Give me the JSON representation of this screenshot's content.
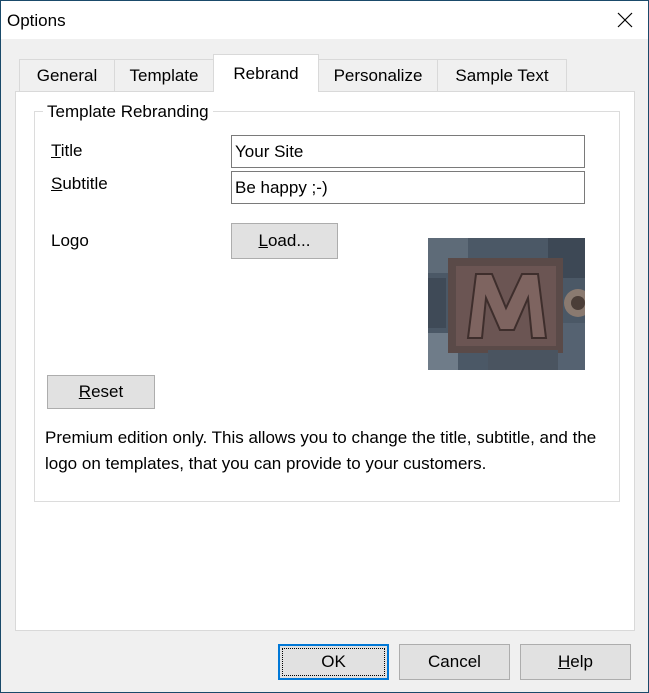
{
  "window": {
    "title": "Options"
  },
  "tabs": [
    {
      "label": "General"
    },
    {
      "label": "Template"
    },
    {
      "label": "Rebrand"
    },
    {
      "label": "Personalize"
    },
    {
      "label": "Sample Text"
    }
  ],
  "active_tab": "Rebrand",
  "group": {
    "title": "Template Rebranding",
    "title_label": {
      "mnemonic": "T",
      "rest": "itle"
    },
    "title_value": "Your Site",
    "subtitle_label": {
      "mnemonic": "S",
      "rest": "ubtitle"
    },
    "subtitle_value": "Be happy ;-)",
    "logo_label": "Logo",
    "load_button": {
      "mnemonic": "L",
      "rest": "oad..."
    },
    "reset_button": {
      "mnemonic": "R",
      "rest": "eset"
    },
    "description": "Premium edition only. This allows you to change the title, subtitle, and the logo on templates, that you can provide to your customers."
  },
  "footer": {
    "ok_label": "OK",
    "cancel_label": "Cancel",
    "help_label": {
      "mnemonic": "H",
      "rest": "elp"
    }
  },
  "colors": {
    "accent": "#0078d7",
    "window_border": "#1a4a6a",
    "dialog_bg": "#f0f0f0"
  }
}
